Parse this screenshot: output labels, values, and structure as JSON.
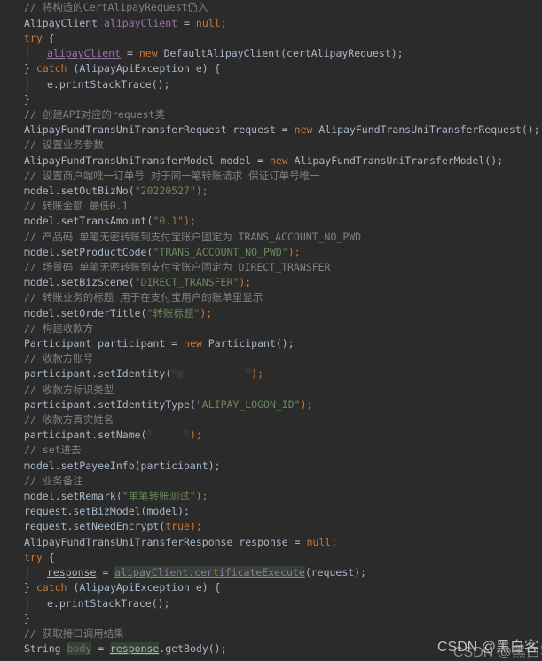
{
  "code": {
    "l01": "// 将构造的CertAlipayRequest仍入",
    "l02a": "AlipayClient ",
    "l02b": "alipayClient",
    "l02c": " = ",
    "l02d": "null",
    "l02e": ";",
    "l03a": "try",
    "l03b": " {",
    "l04a": "alipayClient",
    "l04b": " = ",
    "l04c": "new",
    "l04d": " DefaultAlipayClient(certAlipayRequest);",
    "l05a": "} ",
    "l05b": "catch",
    "l05c": " (AlipayApiException e) {",
    "l06": "e.printStackTrace();",
    "l07": "}",
    "l08": "// 创建API对应的request类",
    "l09a": "AlipayFundTransUniTransferRequest request = ",
    "l09b": "new",
    "l09c": " AlipayFundTransUniTransferRequest();",
    "l10": "// 设置业务参数",
    "l11a": "AlipayFundTransUniTransferModel model = ",
    "l11b": "new",
    "l11c": " AlipayFundTransUniTransferModel();",
    "l12": "// 设置商户端唯一订单号 对于同一笔转账请求 保证订单号唯一",
    "l13a": "model.setOutBizNo(",
    "l13b": "\"20220527\"",
    "l13c": ");",
    "l14": "// 转账金额 最低0.1",
    "l15a": "model.setTransAmount(",
    "l15b": "\"0.1\"",
    "l15c": ");",
    "l16": "// 产品码 单笔无密转账到支付宝账户固定为 TRANS_ACCOUNT_NO_PWD",
    "l17a": "model.setProductCode(",
    "l17b": "\"TRANS_ACCOUNT_NO_PWD\"",
    "l17c": ");",
    "l18": "// 场景码 单笔无密转账到支付宝账户固定为 DIRECT_TRANSFER",
    "l19a": "model.setBizScene(",
    "l19b": "\"DIRECT_TRANSFER\"",
    "l19c": ");",
    "l20": "// 转账业务的标题 用于在支付宝用户的账单里显示",
    "l21a": "model.setOrderTitle(",
    "l21b": "\"转账标题\"",
    "l21c": ");",
    "l22": "// 构建收款方",
    "l23a": "Participant participant = ",
    "l23b": "new",
    "l23c": " Participant();",
    "l24": "// 收款方账号",
    "l25a": "participant.setIdentity(",
    "l25b": "\"c          \"",
    "l25c": ");",
    "l26": "// 收款方标识类型",
    "l27a": "participant.setIdentityType(",
    "l27b": "\"ALIPAY_LOGON_ID\"",
    "l27c": ");",
    "l28": "// 收款方真实姓名",
    "l29a": "participant.setName(",
    "l29b": "\"     \"",
    "l29c": ");",
    "l30": "// set进去",
    "l31": "model.setPayeeInfo(participant);",
    "l32": "// 业务备注",
    "l33a": "model.setRemark(",
    "l33b": "\"单笔转账测试\"",
    "l33c": ");",
    "l34": "request.setBizModel(model);",
    "l35a": "request.setNeedEncrypt(",
    "l35b": "true",
    "l35c": ");",
    "l36a": "AlipayFundTransUniTransferResponse ",
    "l36b": "response",
    "l36c": " = ",
    "l36d": "null",
    "l36e": ";",
    "l37a": "try",
    "l37b": " {",
    "l38a": "response",
    "l38b": " = ",
    "l38c": "alipayClient.certificateExecute",
    "l38d": "(request);",
    "l39a": "} ",
    "l39b": "catch",
    "l39c": " (AlipayApiException e) {",
    "l40": "e.printStackTrace();",
    "l41": "}",
    "l42": "// 获取接口调用结果",
    "l43a": "String ",
    "l43b": "body",
    "l43c": " = ",
    "l43d": "response",
    "l43e": ".getBody();"
  },
  "watermark": "CSDN @黑白客",
  "colors": {
    "background": "#2b2b2b",
    "text": "#a9b7c6",
    "comment": "#808080",
    "keyword": "#cc7832",
    "string": "#6a8759",
    "field": "#9876aa"
  }
}
